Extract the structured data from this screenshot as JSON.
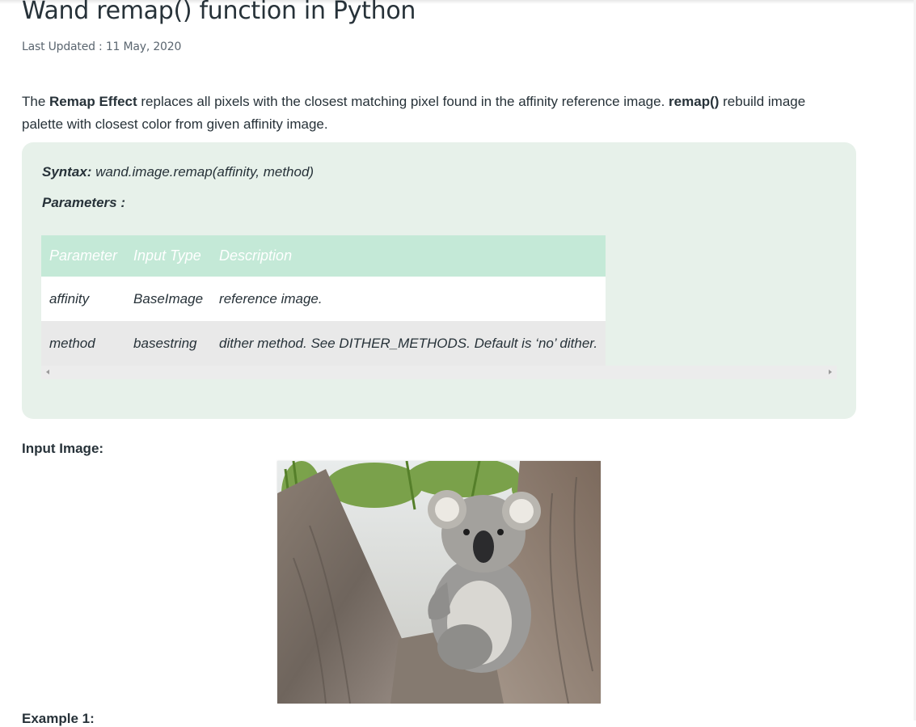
{
  "article": {
    "title": "Wand remap() function in Python",
    "last_updated": "Last Updated : 11 May, 2020",
    "intro": {
      "part1": "The ",
      "bold1": "Remap Effect",
      "part2": " replaces all pixels with the closest matching pixel found in the affinity reference image. ",
      "bold2": "remap()",
      "part3": " rebuild image palette with closest color from given affinity image."
    }
  },
  "syntax_box": {
    "syntax_label": "Syntax:",
    "syntax_value": " wand.image.remap(affinity, method)",
    "parameters_heading": "Parameters :",
    "table": {
      "headers": [
        "Parameter",
        "Input Type",
        "Description"
      ],
      "rows": [
        [
          "affinity",
          "BaseImage",
          "reference image."
        ],
        [
          "method",
          "basestring",
          "dither method. See DITHER_METHODS. Default is ‘no’ dither."
        ]
      ]
    }
  },
  "input_image": {
    "label": "Input Image:",
    "image_subject": "koala-in-tree"
  },
  "example": {
    "label": "Example 1:"
  },
  "colors": {
    "syntax_box_bg": "#e7f1ea",
    "table_header_bg": "#c4e9d7",
    "text": "#273239"
  }
}
